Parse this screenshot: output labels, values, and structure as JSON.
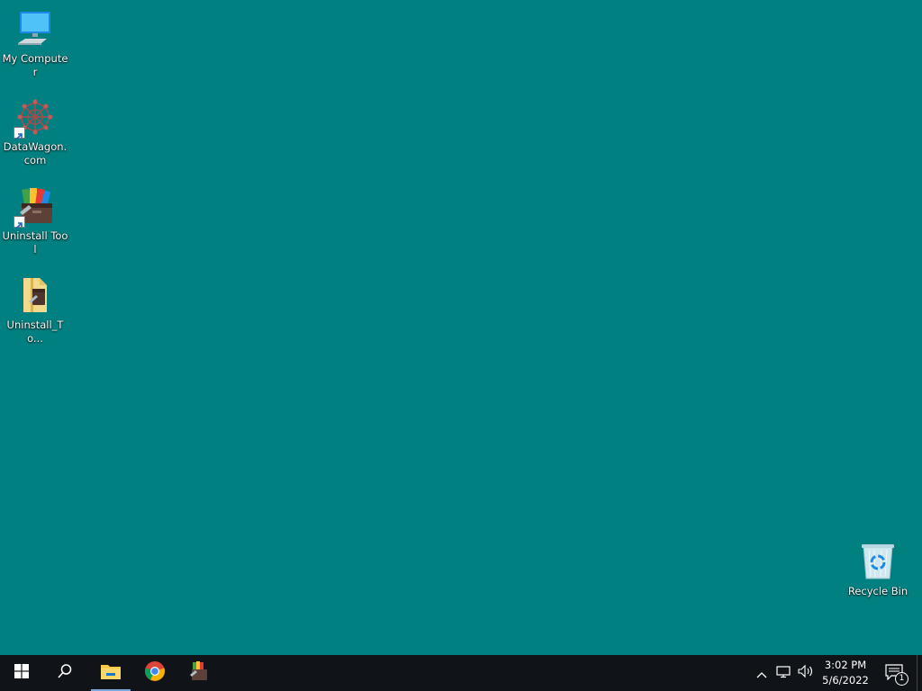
{
  "desktop": {
    "icons": [
      {
        "label": "My Computer",
        "icon": "computer-icon"
      },
      {
        "label": "DataWagon.com",
        "icon": "datawagon-icon"
      },
      {
        "label": "Uninstall Tool",
        "icon": "uninstall-tool-icon"
      },
      {
        "label": "Uninstall_To...",
        "icon": "folder-archive-icon"
      },
      {
        "label": "Recycle Bin",
        "icon": "recycle-bin-icon"
      }
    ]
  },
  "taskbar": {
    "start": "windows-start-icon",
    "search": "search-icon",
    "pinned": [
      {
        "name": "File Explorer",
        "icon": "file-explorer-icon",
        "active": true
      },
      {
        "name": "Google Chrome",
        "icon": "chrome-icon",
        "active": false
      },
      {
        "name": "Uninstall Tool",
        "icon": "uninstall-tool-icon",
        "active": false
      }
    ],
    "clock": {
      "time": "3:02 PM",
      "date": "5/6/2022"
    },
    "notification_count": "1"
  },
  "colors": {
    "desktop_bg": "#008080",
    "taskbar_bg": "#101418",
    "accent": "#7aa7d9"
  }
}
